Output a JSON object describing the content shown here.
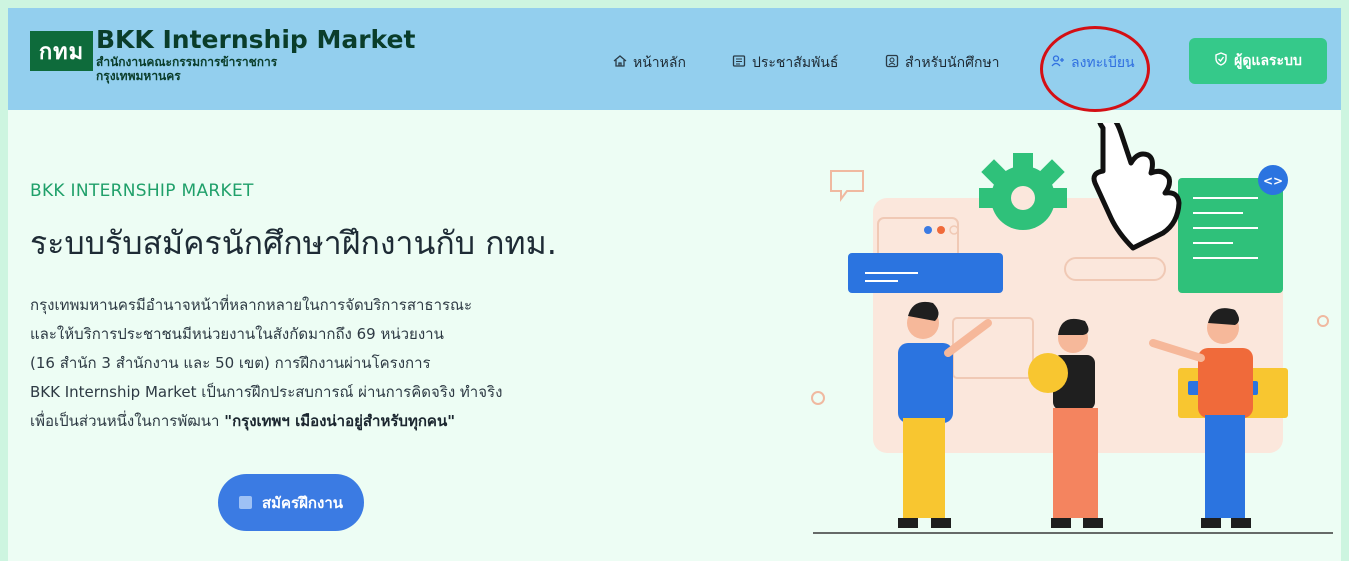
{
  "brand": {
    "logo_text": "กทม",
    "title": "BKK Internship Market",
    "subtitle": "สำนักงานคณะกรรมการข้าราชการ\nกรุงเทพมหานคร"
  },
  "nav": {
    "home": "หน้าหลัก",
    "news": "ประชาสัมพันธ์",
    "students": "สำหรับนักศึกษา",
    "register": "ลงทะเบียน",
    "admin": "ผู้ดูแลระบบ"
  },
  "icons": {
    "home": "home-icon",
    "news": "newspaper-icon",
    "students": "student-card-icon",
    "register": "user-plus-icon",
    "admin": "shield-check-icon"
  },
  "hero": {
    "eyebrow": "BKK INTERNSHIP MARKET",
    "headline": "ระบบรับสมัครนักศึกษาฝึกงานกับ กทม.",
    "desc_lines": [
      "กรุงเทพมหานครมีอำนาจหน้าที่หลากหลายในการจัดบริการสาธารณะ",
      "และให้บริการประชาชนมีหน่วยงานในสังกัดมากถึง 69 หน่วยงาน",
      "(16 สำนัก 3 สำนักงาน และ 50 เขต) การฝึกงานผ่านโครงการ",
      "BKK Internship Market เป็นการฝึกประสบการณ์ ผ่านการคิดจริง ทำจริง",
      "เพื่อเป็นส่วนหนึ่งในการพัฒนา "
    ],
    "desc_bold": "\"กรุงเทพฯ เมืองน่าอยู่สำหรับทุกคน\"",
    "apply_button": "สมัครฝึกงาน"
  },
  "colors": {
    "header_bg": "#93cfee",
    "page_bg": "#edfdf4",
    "accent_green": "#35c98a",
    "primary_blue": "#3b7be3",
    "logo_green": "#0e6b3b",
    "highlight_red": "#d40f14"
  }
}
